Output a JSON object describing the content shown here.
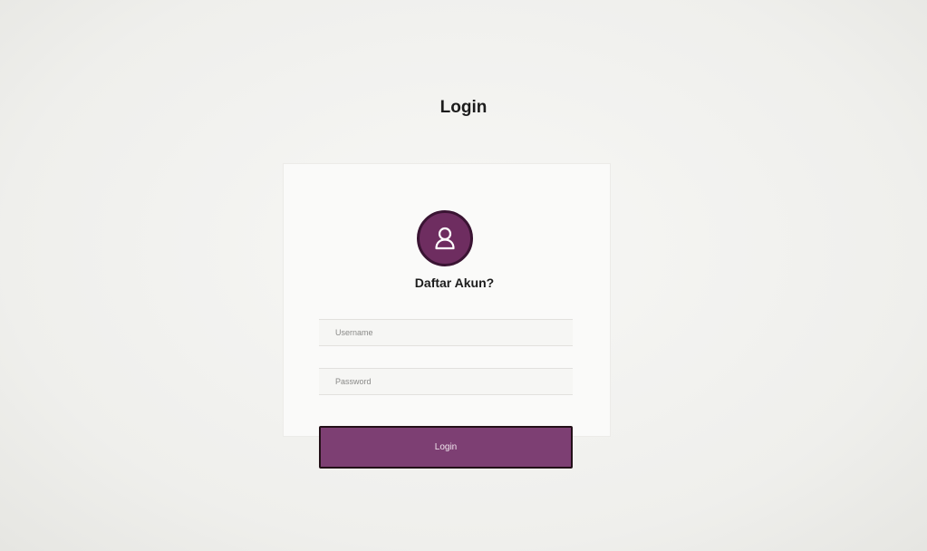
{
  "header": {
    "title": "Login"
  },
  "form": {
    "register_link": "Daftar Akun?",
    "username": {
      "placeholder": "Username",
      "value": ""
    },
    "password": {
      "placeholder": "Password",
      "value": ""
    },
    "submit_label": "Login"
  },
  "icons": {
    "avatar": "user-icon"
  },
  "colors": {
    "accent": "#7d3f73",
    "accent_border": "#231018",
    "background": "#f3f3f1"
  }
}
